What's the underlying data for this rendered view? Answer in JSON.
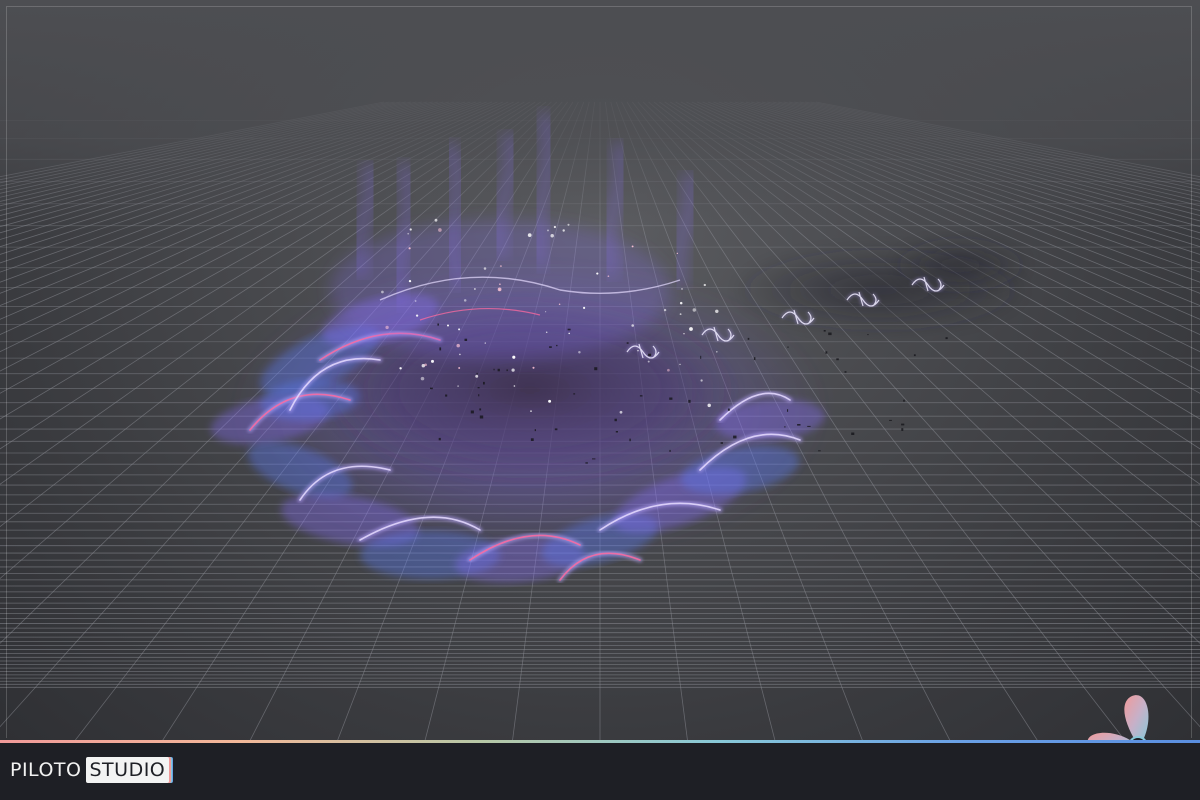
{
  "brand": {
    "name_main": "PILOTO",
    "name_box": "STUDIO"
  },
  "icons": {
    "logo": "propeller-logo-icon"
  },
  "colors": {
    "viewport_bg": "#4a4b4f",
    "grid_line": "#8a8c93",
    "fx_primary": "#8a6cff",
    "fx_secondary": "#5a7bff",
    "fx_accent": "#ff6aa0",
    "footer_bg": "#1e1f25",
    "logo_pink": "#f19a9a",
    "logo_blue": "#88c8d8",
    "logo_dark": "#2e3a4a"
  }
}
